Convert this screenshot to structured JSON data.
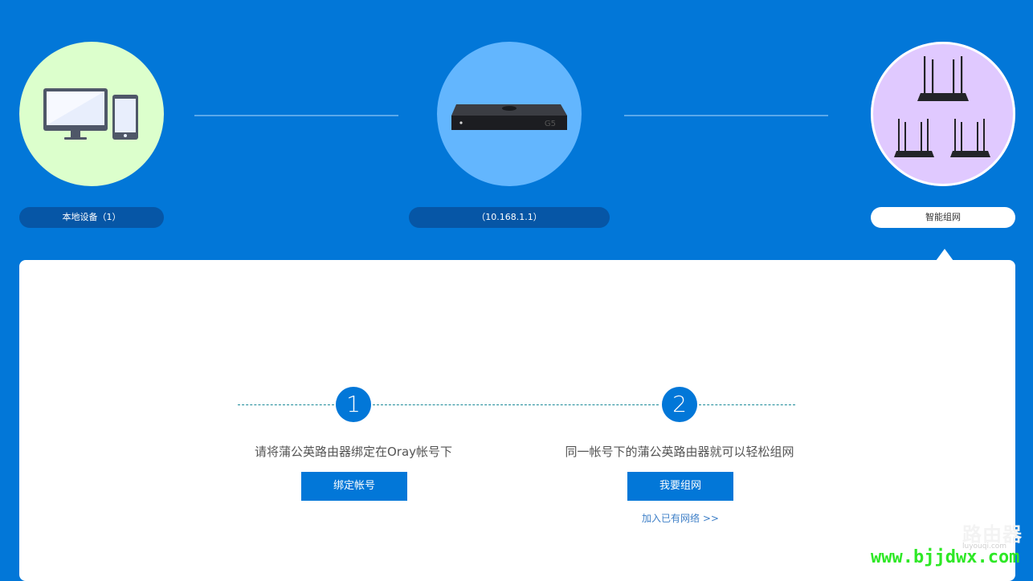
{
  "nodes": {
    "local": {
      "label": "本地设备（1）",
      "icon": "desktop-tablet-icon"
    },
    "router": {
      "label": "（10.168.1.1）",
      "icon": "router-box-icon",
      "model_mark": "G5"
    },
    "mesh": {
      "label": "智能组网",
      "icon": "mesh-routers-icon"
    }
  },
  "steps": [
    {
      "number": "1",
      "text": "请将蒲公英路由器绑定在Oray帐号下",
      "button": "绑定帐号"
    },
    {
      "number": "2",
      "text": "同一帐号下的蒲公英路由器就可以轻松组网",
      "button": "我要组网"
    }
  ],
  "join_link": "加入已有网络 >>",
  "watermark": {
    "brand": "路由器",
    "sub": "luyouqi.com",
    "url": "www.bjjdwx.com"
  },
  "colors": {
    "background": "#0277d8",
    "accent": "#0277d8",
    "panel": "#ffffff",
    "watermark_url": "#2ee826"
  }
}
